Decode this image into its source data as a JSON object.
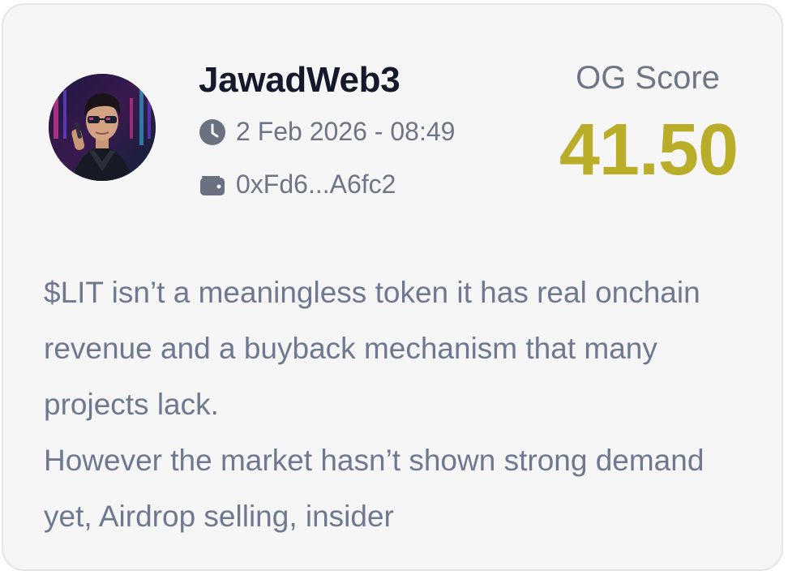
{
  "post": {
    "username": "JawadWeb3",
    "timestamp": "2 Feb 2026 - 08:49",
    "wallet": "0xFd6...A6fc2",
    "score_label": "OG Score",
    "score_value": "41.50",
    "body_paragraphs": [
      "$LIT isn’t a meaningless token it has real onchain revenue and a buyback mechanism that many projects lack.",
      "However the market hasn’t shown strong demand yet, Airdrop selling, insider"
    ]
  },
  "icons": {
    "time": "clock-icon",
    "wallet": "wallet-icon"
  },
  "colors": {
    "card_background": "#f6f6f6",
    "username": "#141a2b",
    "meta_text": "#6e7585",
    "score_value": "#b9ad2a",
    "body_text": "#6e7890"
  }
}
